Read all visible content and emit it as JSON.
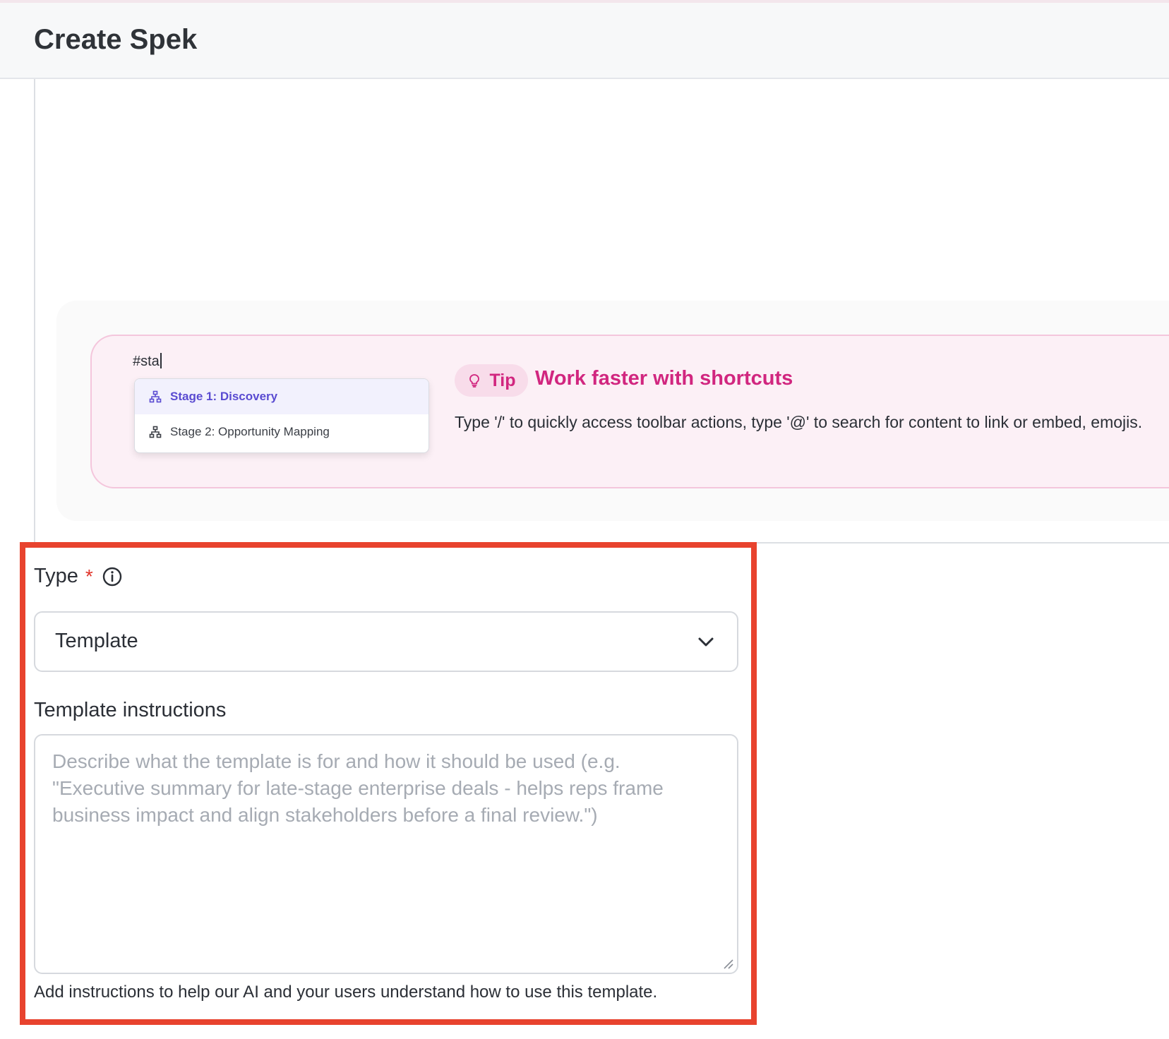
{
  "header": {
    "title": "Create Spek"
  },
  "tip_preview": {
    "typed_text": "#sta",
    "suggestions": [
      {
        "label": "Stage 1: Discovery",
        "icon": "hierarchy-icon",
        "active": true
      },
      {
        "label": "Stage 2: Opportunity Mapping",
        "icon": "hierarchy-icon",
        "active": false
      }
    ]
  },
  "tip": {
    "badge": "Tip",
    "badge_icon": "lightbulb-icon",
    "title": "Work faster with shortcuts",
    "body": "Type '/' to quickly access toolbar actions, type '@' to search for content to link or embed, emojis."
  },
  "form": {
    "type_label": "Type",
    "required_mark": "*",
    "type_value": "Template",
    "instructions_label": "Template instructions",
    "instructions_placeholder": "Describe what the template is for and how it should be used (e.g. \"Executive summary for late-stage enterprise deals - helps reps frame business impact and align stakeholders before a final review.\")",
    "helper_text": "Add instructions to help our AI and your users understand how to use this template."
  },
  "colors": {
    "accent_pink": "#d1267f",
    "suggestion_active": "#5a4bd1",
    "highlight_border": "#e8432e",
    "required": "#e0342a"
  }
}
